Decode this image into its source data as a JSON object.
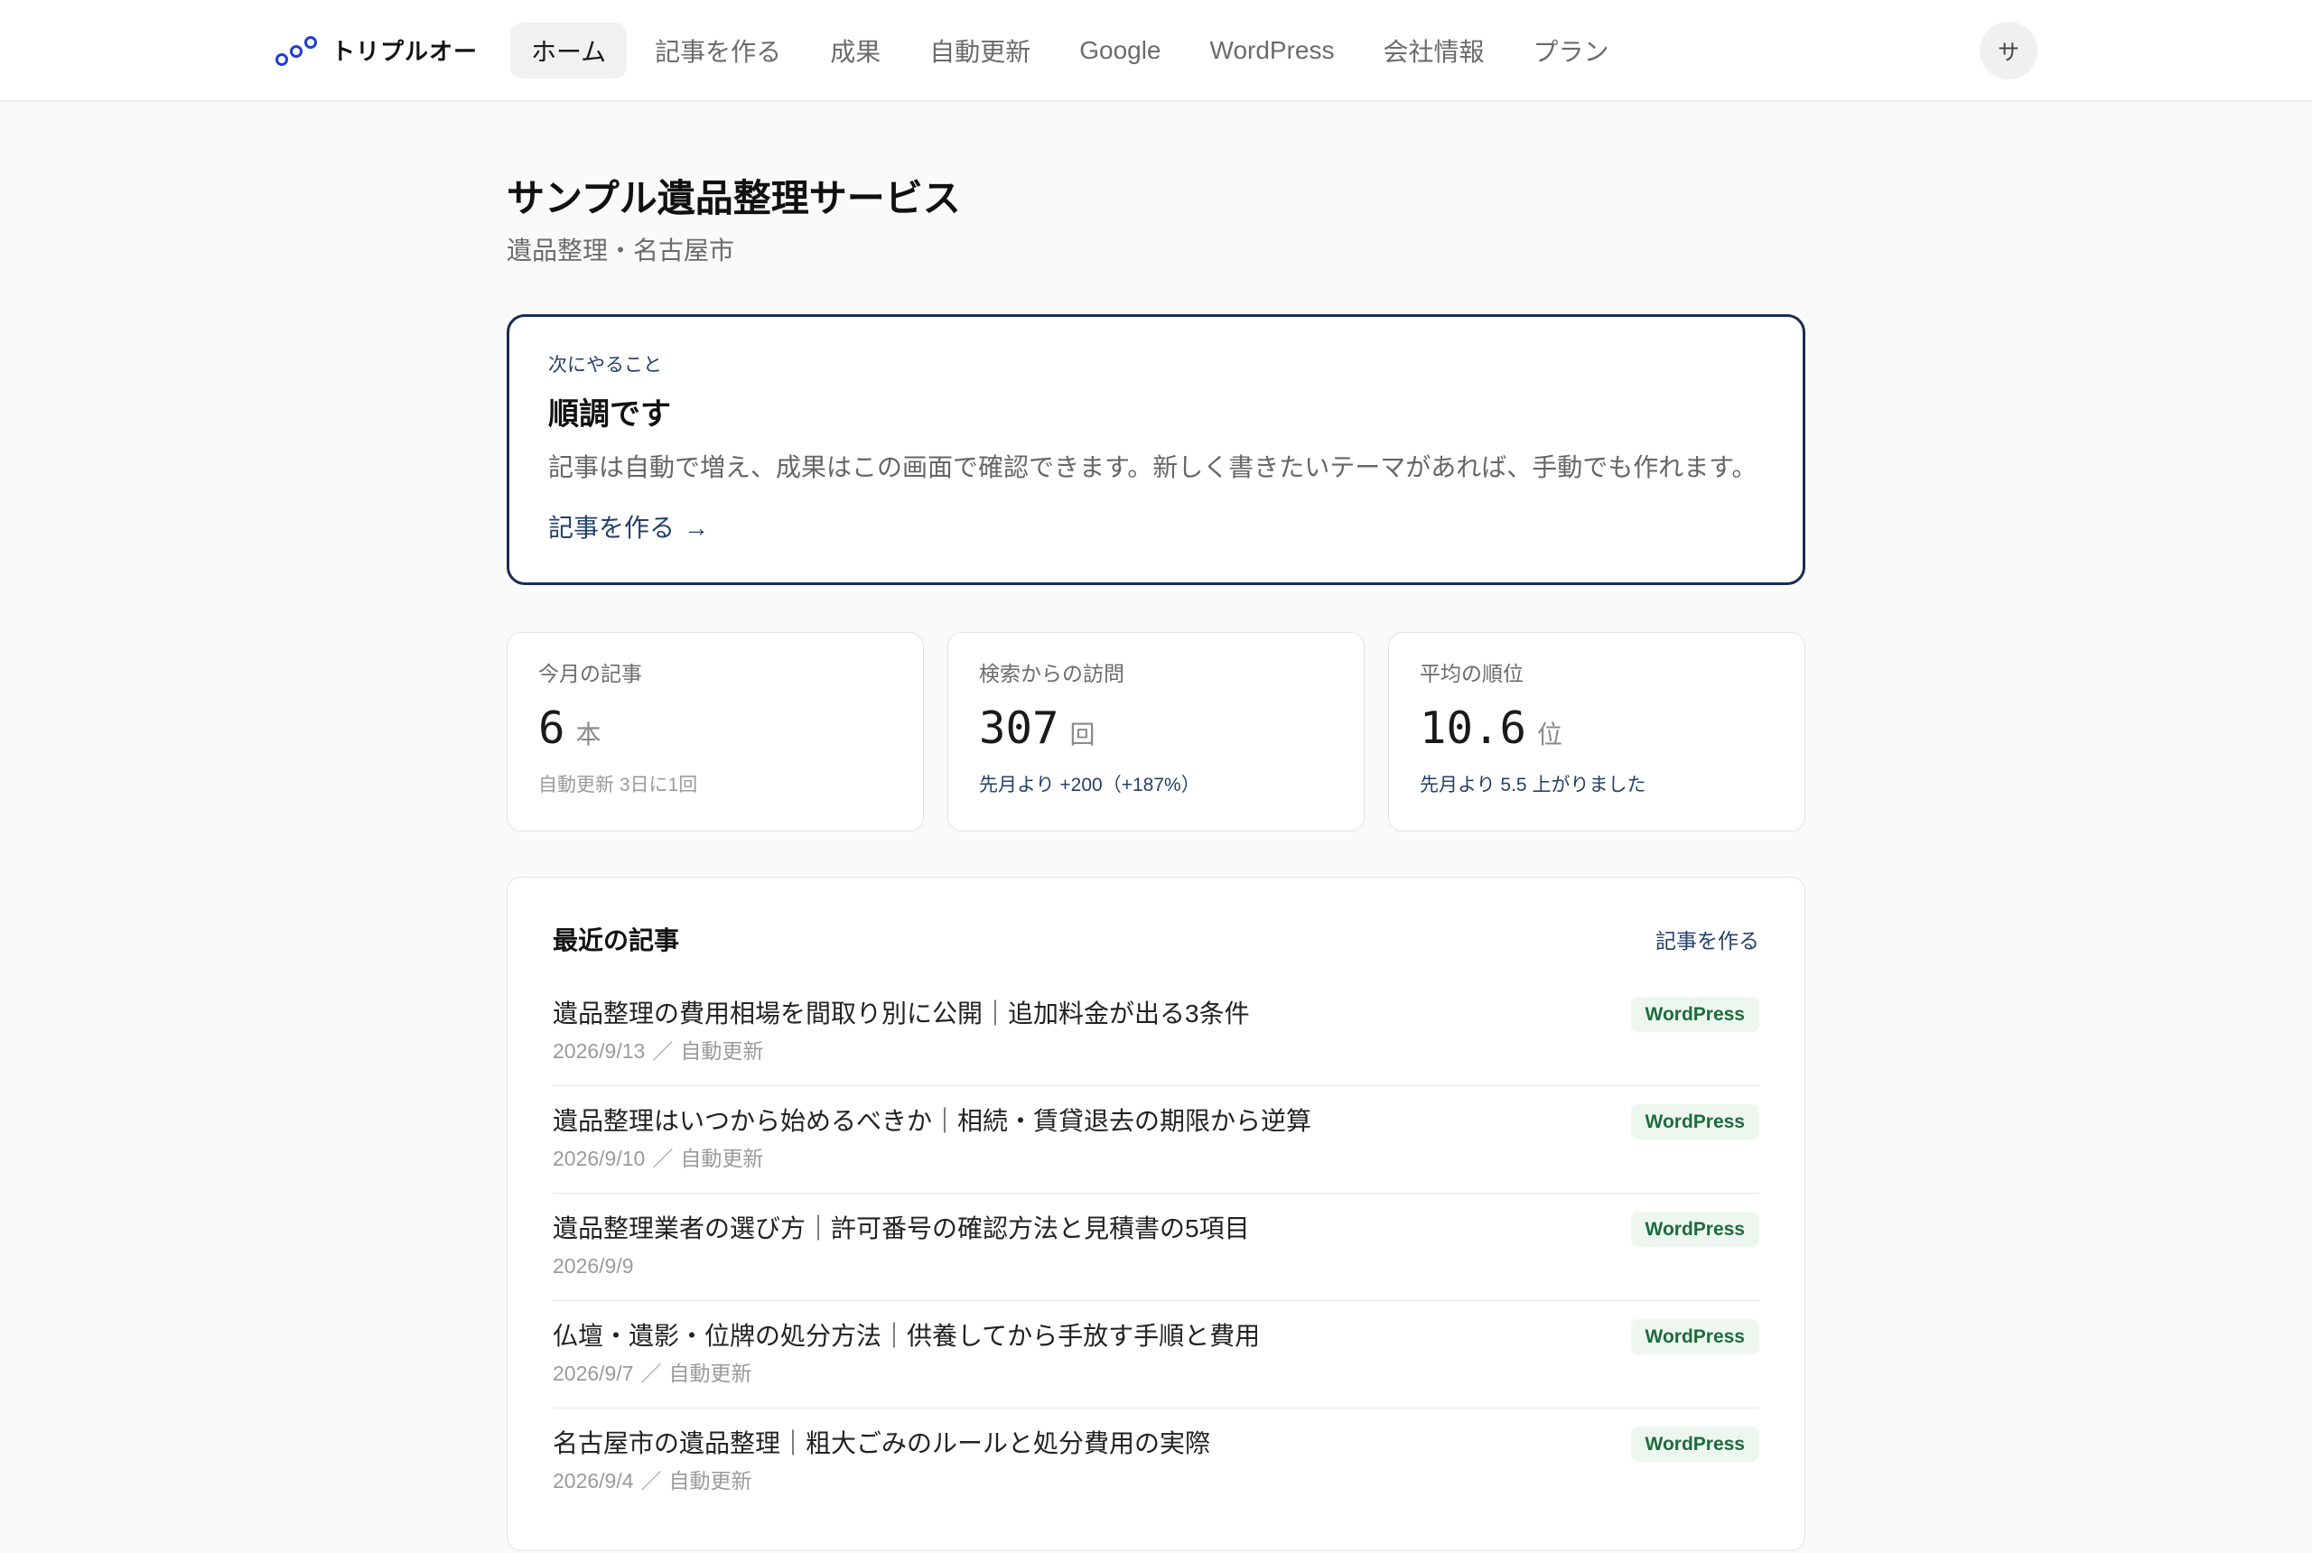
{
  "colors": {
    "accent": "#24406b",
    "accent_border": "#1b2d4f",
    "badge_text": "#1e6b3c",
    "badge_bg": "#edf7ef",
    "page_bg": "#fafafa",
    "logo": "#1b3fd8"
  },
  "brand": {
    "name": "トリプルオー",
    "logo_icon": "three-circles-logo-icon"
  },
  "nav": {
    "items": [
      {
        "label": "ホーム",
        "active": true
      },
      {
        "label": "記事を作る",
        "active": false
      },
      {
        "label": "成果",
        "active": false
      },
      {
        "label": "自動更新",
        "active": false
      },
      {
        "label": "Google",
        "active": false
      },
      {
        "label": "WordPress",
        "active": false
      },
      {
        "label": "会社情報",
        "active": false
      },
      {
        "label": "プラン",
        "active": false
      }
    ]
  },
  "user": {
    "avatar_initial": "サ"
  },
  "page": {
    "title": "サンプル遺品整理サービス",
    "subtitle": "遺品整理・名古屋市"
  },
  "next_action": {
    "eyebrow": "次にやること",
    "heading": "順調です",
    "description": "記事は自動で増え、成果はこの画面で確認できます。新しく書きたいテーマがあれば、手動でも作れます。",
    "link_label": "記事を作る",
    "link_icon": "arrow-right-icon",
    "link_arrow": "→"
  },
  "stats": [
    {
      "label": "今月の記事",
      "value": "6",
      "unit": "本",
      "note": "自動更新 3日に1回"
    },
    {
      "label": "検索からの訪問",
      "value": "307",
      "unit": "回",
      "note": "先月より +200（+187%）"
    },
    {
      "label": "平均の順位",
      "value": "10.6",
      "unit": "位",
      "note": "先月より 5.5 上がりました"
    }
  ],
  "recent": {
    "title": "最近の記事",
    "create_link": "記事を作る",
    "separator": "／",
    "articles": [
      {
        "title": "遺品整理の費用相場を間取り別に公開｜追加料金が出る3条件",
        "date": "2026/9/13",
        "source": "自動更新",
        "platform": "WordPress"
      },
      {
        "title": "遺品整理はいつから始めるべきか｜相続・賃貸退去の期限から逆算",
        "date": "2026/9/10",
        "source": "自動更新",
        "platform": "WordPress"
      },
      {
        "title": "遺品整理業者の選び方｜許可番号の確認方法と見積書の5項目",
        "date": "2026/9/9",
        "platform": "WordPress"
      },
      {
        "title": "仏壇・遺影・位牌の処分方法｜供養してから手放す手順と費用",
        "date": "2026/9/7",
        "source": "自動更新",
        "platform": "WordPress"
      },
      {
        "title": "名古屋市の遺品整理｜粗大ごみのルールと処分費用の実際",
        "date": "2026/9/4",
        "source": "自動更新",
        "platform": "WordPress"
      }
    ]
  }
}
